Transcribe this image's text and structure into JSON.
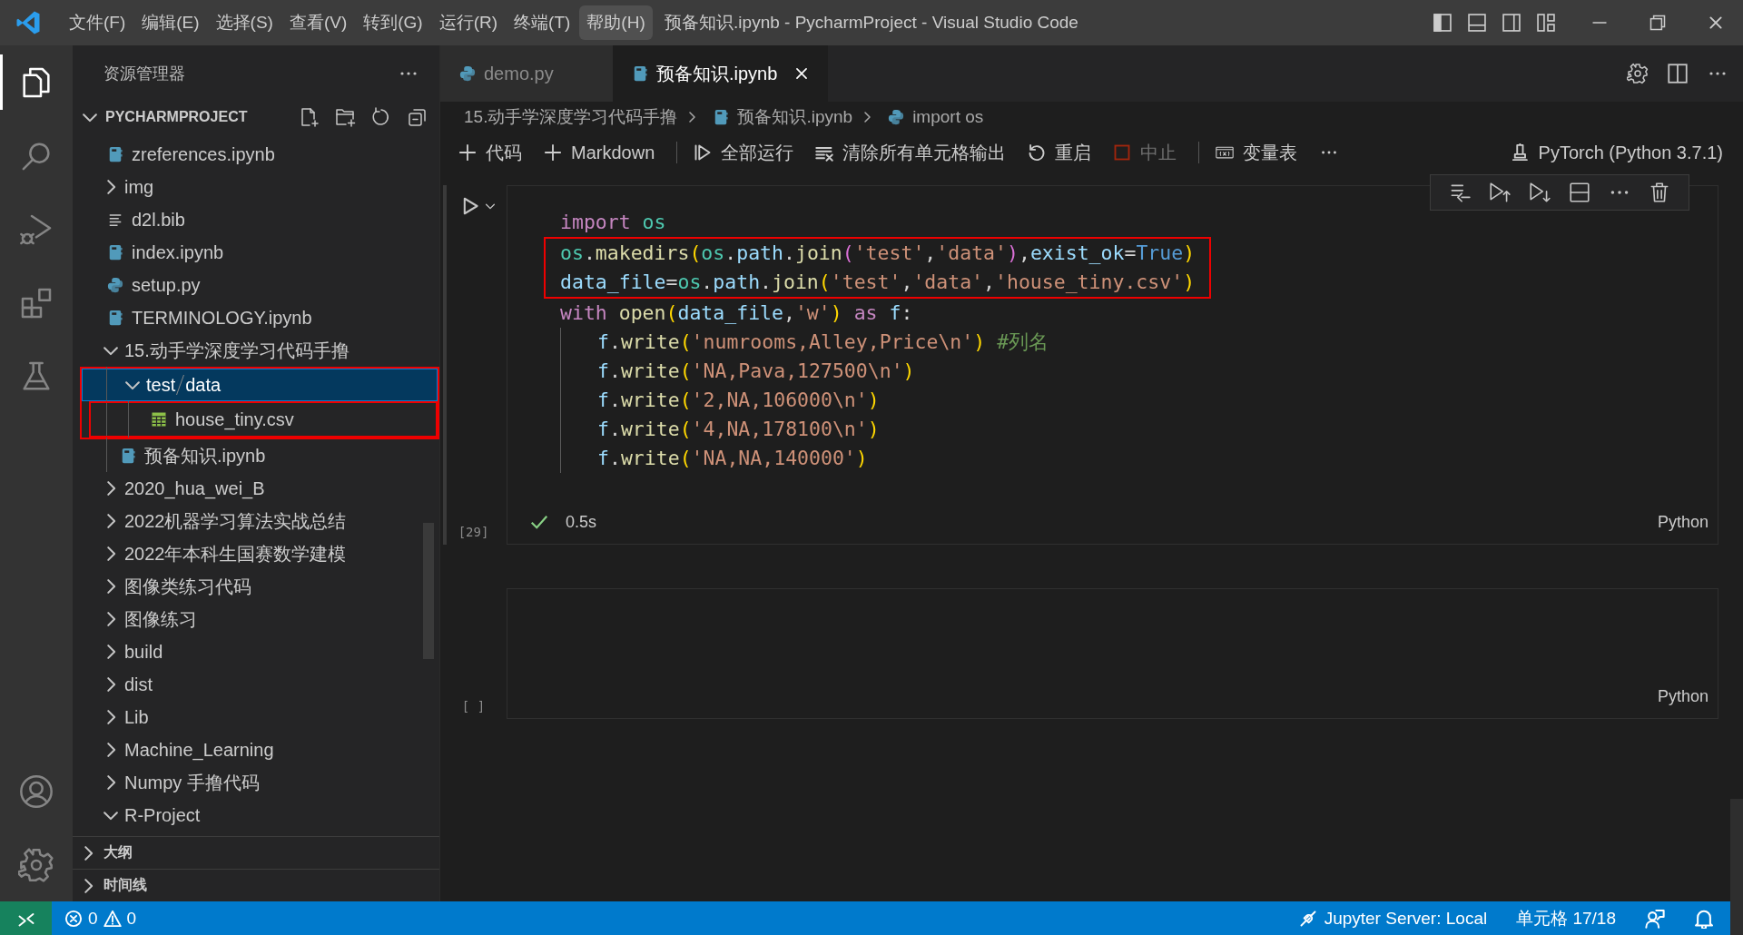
{
  "title_bar": {
    "menus": [
      {
        "label": "文件(F)",
        "selected": false
      },
      {
        "label": "编辑(E)",
        "selected": false
      },
      {
        "label": "选择(S)",
        "selected": false
      },
      {
        "label": "查看(V)",
        "selected": false
      },
      {
        "label": "转到(G)",
        "selected": false
      },
      {
        "label": "运行(R)",
        "selected": false
      },
      {
        "label": "终端(T)",
        "selected": false
      },
      {
        "label": "帮助(H)",
        "selected": true
      }
    ],
    "title": "预备知识.ipynb - PycharmProject - Visual Studio Code"
  },
  "activity_bar": {
    "items": [
      {
        "kind": "explorer",
        "selected": true
      },
      {
        "kind": "search",
        "selected": false
      },
      {
        "kind": "run-debug",
        "selected": false
      },
      {
        "kind": "extensions",
        "selected": false
      },
      {
        "kind": "testing",
        "selected": false
      }
    ],
    "bottom": [
      {
        "kind": "account"
      },
      {
        "kind": "settings"
      }
    ]
  },
  "sidebar": {
    "title": "资源管理器",
    "project": {
      "label": "PYCHARMPROJECT",
      "expanded": true,
      "items": [
        {
          "label": "zreferences.ipynb",
          "kind": "notebook",
          "selected": false,
          "annotated": false
        },
        {
          "label": "img",
          "kind": "folder",
          "expanded": false,
          "selected": false,
          "annotated": false
        },
        {
          "label": "d2l.bib",
          "kind": "text",
          "selected": false,
          "annotated": false
        },
        {
          "label": "index.ipynb",
          "kind": "notebook",
          "selected": false,
          "annotated": false
        },
        {
          "label": "setup.py",
          "kind": "python",
          "selected": false,
          "annotated": false
        },
        {
          "label": "TERMINOLOGY.ipynb",
          "kind": "notebook",
          "selected": false,
          "annotated": false
        },
        {
          "label": "15.动手学深度学习代码手撸",
          "kind": "folder",
          "expanded": true,
          "selected": false,
          "annotated": false,
          "children": [
            {
              "path": [
                "test",
                "data"
              ],
              "kind": "folder",
              "expanded": true,
              "selected": true,
              "annotated": true,
              "children": [
                {
                  "label": "house_tiny.csv",
                  "kind": "csv",
                  "selected": false,
                  "annotated": true
                }
              ]
            },
            {
              "label": "预备知识.ipynb",
              "kind": "notebook",
              "selected": false,
              "annotated": false
            }
          ]
        },
        {
          "label": "2020_hua_wei_B",
          "kind": "folder",
          "expanded": false,
          "selected": false,
          "annotated": false
        },
        {
          "label": "2022机器学习算法实战总结",
          "kind": "folder",
          "expanded": false,
          "selected": false,
          "annotated": false
        },
        {
          "label": "2022年本科生国赛数学建模",
          "kind": "folder",
          "expanded": false,
          "selected": false,
          "annotated": false
        },
        {
          "label": "图像类练习代码",
          "kind": "folder",
          "expanded": false,
          "selected": false,
          "annotated": false
        },
        {
          "label": "图像练习",
          "kind": "folder",
          "expanded": false,
          "selected": false,
          "annotated": false
        },
        {
          "label": "build",
          "kind": "folder",
          "expanded": false,
          "selected": false,
          "annotated": false
        },
        {
          "label": "dist",
          "kind": "folder",
          "expanded": false,
          "selected": false,
          "annotated": false
        },
        {
          "label": "Lib",
          "kind": "folder",
          "expanded": false,
          "selected": false,
          "annotated": false
        },
        {
          "label": "Machine_Learning",
          "kind": "folder",
          "expanded": false,
          "selected": false,
          "annotated": false
        },
        {
          "label": "Numpy 手撸代码",
          "kind": "folder",
          "expanded": false,
          "selected": false,
          "annotated": false
        },
        {
          "label": "R-Project",
          "kind": "folder",
          "expanded": true,
          "selected": false,
          "annotated": false
        }
      ]
    },
    "sections": [
      {
        "label": "大纲",
        "expanded": false
      },
      {
        "label": "时间线",
        "expanded": false
      }
    ]
  },
  "tabs": [
    {
      "label": "demo.py",
      "kind": "python",
      "selected": false
    },
    {
      "label": "预备知识.ipynb",
      "kind": "notebook",
      "selected": true
    }
  ],
  "breadcrumbs": [
    {
      "label": "15.动手学深度学习代码手撸",
      "kind": "folder"
    },
    {
      "label": "预备知识.ipynb",
      "kind": "notebook"
    },
    {
      "label": "import os",
      "kind": "python"
    }
  ],
  "toolbar": {
    "items": [
      {
        "label": "代码",
        "kind": "add",
        "disabled": false
      },
      {
        "label": "Markdown",
        "kind": "add",
        "disabled": false
      },
      {
        "kind": "separator"
      },
      {
        "label": "全部运行",
        "kind": "run-all",
        "disabled": false
      },
      {
        "label": "清除所有单元格输出",
        "kind": "clear",
        "disabled": false
      },
      {
        "label": "重启",
        "kind": "restart",
        "disabled": false
      },
      {
        "label": "中止",
        "kind": "stop",
        "disabled": true
      },
      {
        "kind": "separator"
      },
      {
        "label": "变量表",
        "kind": "variables",
        "disabled": false
      },
      {
        "kind": "more"
      }
    ],
    "kernel": "PyTorch (Python 3.7.1)"
  },
  "cells": [
    {
      "focused": true,
      "exec_count": "[29]",
      "succeeded": true,
      "duration": "0.5s",
      "language": "Python",
      "lines": [
        {
          "indented": false,
          "annotated": false,
          "tokens": [
            {
              "text": "import",
              "kind": "keyword"
            },
            {
              "text": " os",
              "kind": "module"
            }
          ]
        },
        {
          "indented": false,
          "annotated": true,
          "tokens": [
            {
              "text": "os",
              "kind": "module"
            },
            {
              "text": ".",
              "kind": "punct"
            },
            {
              "text": "makedirs",
              "kind": "func"
            },
            {
              "text": "(",
              "kind": "bracket1"
            },
            {
              "text": "os",
              "kind": "module"
            },
            {
              "text": ".",
              "kind": "punct"
            },
            {
              "text": "path",
              "kind": "var"
            },
            {
              "text": ".",
              "kind": "punct"
            },
            {
              "text": "join",
              "kind": "func"
            },
            {
              "text": "(",
              "kind": "bracket2"
            },
            {
              "text": "'test'",
              "kind": "string"
            },
            {
              "text": ",",
              "kind": "punct"
            },
            {
              "text": "'data'",
              "kind": "string"
            },
            {
              "text": ")",
              "kind": "bracket2"
            },
            {
              "text": ",",
              "kind": "punct"
            },
            {
              "text": "exist_ok",
              "kind": "var"
            },
            {
              "text": "=",
              "kind": "punct"
            },
            {
              "text": "True",
              "kind": "const"
            },
            {
              "text": ")",
              "kind": "bracket1"
            }
          ]
        },
        {
          "indented": false,
          "annotated": true,
          "tokens": [
            {
              "text": "data_file",
              "kind": "var"
            },
            {
              "text": "=",
              "kind": "punct"
            },
            {
              "text": "os",
              "kind": "module"
            },
            {
              "text": ".",
              "kind": "punct"
            },
            {
              "text": "path",
              "kind": "var"
            },
            {
              "text": ".",
              "kind": "punct"
            },
            {
              "text": "join",
              "kind": "func"
            },
            {
              "text": "(",
              "kind": "bracket1"
            },
            {
              "text": "'test'",
              "kind": "string"
            },
            {
              "text": ",",
              "kind": "punct"
            },
            {
              "text": "'data'",
              "kind": "string"
            },
            {
              "text": ",",
              "kind": "punct"
            },
            {
              "text": "'house_tiny.csv'",
              "kind": "string"
            },
            {
              "text": ")",
              "kind": "bracket1"
            }
          ]
        },
        {
          "indented": false,
          "annotated": false,
          "tokens": [
            {
              "text": "with",
              "kind": "keyword"
            },
            {
              "text": " open",
              "kind": "func"
            },
            {
              "text": "(",
              "kind": "bracket1"
            },
            {
              "text": "data_file",
              "kind": "var"
            },
            {
              "text": ",",
              "kind": "punct"
            },
            {
              "text": "'w'",
              "kind": "string"
            },
            {
              "text": ")",
              "kind": "bracket1"
            },
            {
              "text": " as",
              "kind": "keyword"
            },
            {
              "text": " f",
              "kind": "var"
            },
            {
              "text": ":",
              "kind": "punct"
            }
          ]
        },
        {
          "indented": true,
          "annotated": false,
          "tokens": [
            {
              "text": "f",
              "kind": "var"
            },
            {
              "text": ".",
              "kind": "punct"
            },
            {
              "text": "write",
              "kind": "func"
            },
            {
              "text": "(",
              "kind": "bracket1"
            },
            {
              "text": "'numrooms,Alley,Price\\n'",
              "kind": "string"
            },
            {
              "text": ")",
              "kind": "bracket1"
            },
            {
              "text": " #列名",
              "kind": "comment"
            }
          ]
        },
        {
          "indented": true,
          "annotated": false,
          "tokens": [
            {
              "text": "f",
              "kind": "var"
            },
            {
              "text": ".",
              "kind": "punct"
            },
            {
              "text": "write",
              "kind": "func"
            },
            {
              "text": "(",
              "kind": "bracket1"
            },
            {
              "text": "'NA,Pava,127500\\n'",
              "kind": "string"
            },
            {
              "text": ")",
              "kind": "bracket1"
            }
          ]
        },
        {
          "indented": true,
          "annotated": false,
          "tokens": [
            {
              "text": "f",
              "kind": "var"
            },
            {
              "text": ".",
              "kind": "punct"
            },
            {
              "text": "write",
              "kind": "func"
            },
            {
              "text": "(",
              "kind": "bracket1"
            },
            {
              "text": "'2,NA,106000\\n'",
              "kind": "string"
            },
            {
              "text": ")",
              "kind": "bracket1"
            }
          ]
        },
        {
          "indented": true,
          "annotated": false,
          "tokens": [
            {
              "text": "f",
              "kind": "var"
            },
            {
              "text": ".",
              "kind": "punct"
            },
            {
              "text": "write",
              "kind": "func"
            },
            {
              "text": "(",
              "kind": "bracket1"
            },
            {
              "text": "'4,NA,178100\\n'",
              "kind": "string"
            },
            {
              "text": ")",
              "kind": "bracket1"
            }
          ]
        },
        {
          "indented": true,
          "annotated": false,
          "tokens": [
            {
              "text": "f",
              "kind": "var"
            },
            {
              "text": ".",
              "kind": "punct"
            },
            {
              "text": "write",
              "kind": "func"
            },
            {
              "text": "(",
              "kind": "bracket1"
            },
            {
              "text": "'NA,NA,140000'",
              "kind": "string"
            },
            {
              "text": ")",
              "kind": "bracket1"
            }
          ]
        }
      ]
    },
    {
      "focused": false,
      "exec_count": "[ ]",
      "succeeded": false,
      "language": "Python"
    }
  ],
  "status_bar": {
    "errors": "0",
    "warnings": "0",
    "items": [
      {
        "label": "Jupyter Server: Local",
        "kind": "jupyter"
      },
      {
        "label": "单元格 17/18",
        "kind": "text"
      },
      {
        "kind": "feedback"
      },
      {
        "kind": "bell"
      }
    ]
  }
}
